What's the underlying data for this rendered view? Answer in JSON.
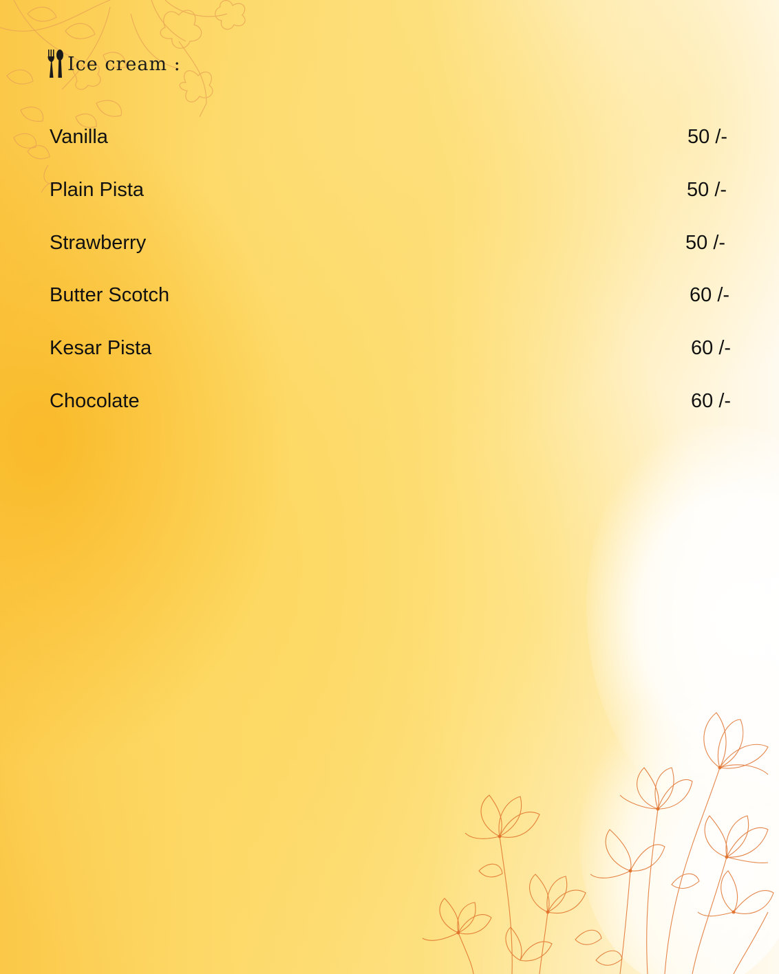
{
  "heading": {
    "title": "Ice cream :",
    "icon": "fork-spoon-icon"
  },
  "menu": {
    "items": [
      {
        "name": "Vanilla",
        "price": "50 /-"
      },
      {
        "name": "Plain Pista",
        "price": "50 /-"
      },
      {
        "name": "Strawberry",
        "price": "50 /-"
      },
      {
        "name": "Butter Scotch",
        "price": "60 /-"
      },
      {
        "name": "Kesar Pista",
        "price": "60 /-"
      },
      {
        "name": "Chocolate",
        "price": "60 /-"
      }
    ]
  },
  "colors": {
    "accent": "#fdd867",
    "deep_accent": "#fbc848",
    "line_art": "#e07a2a",
    "text": "#111111"
  }
}
